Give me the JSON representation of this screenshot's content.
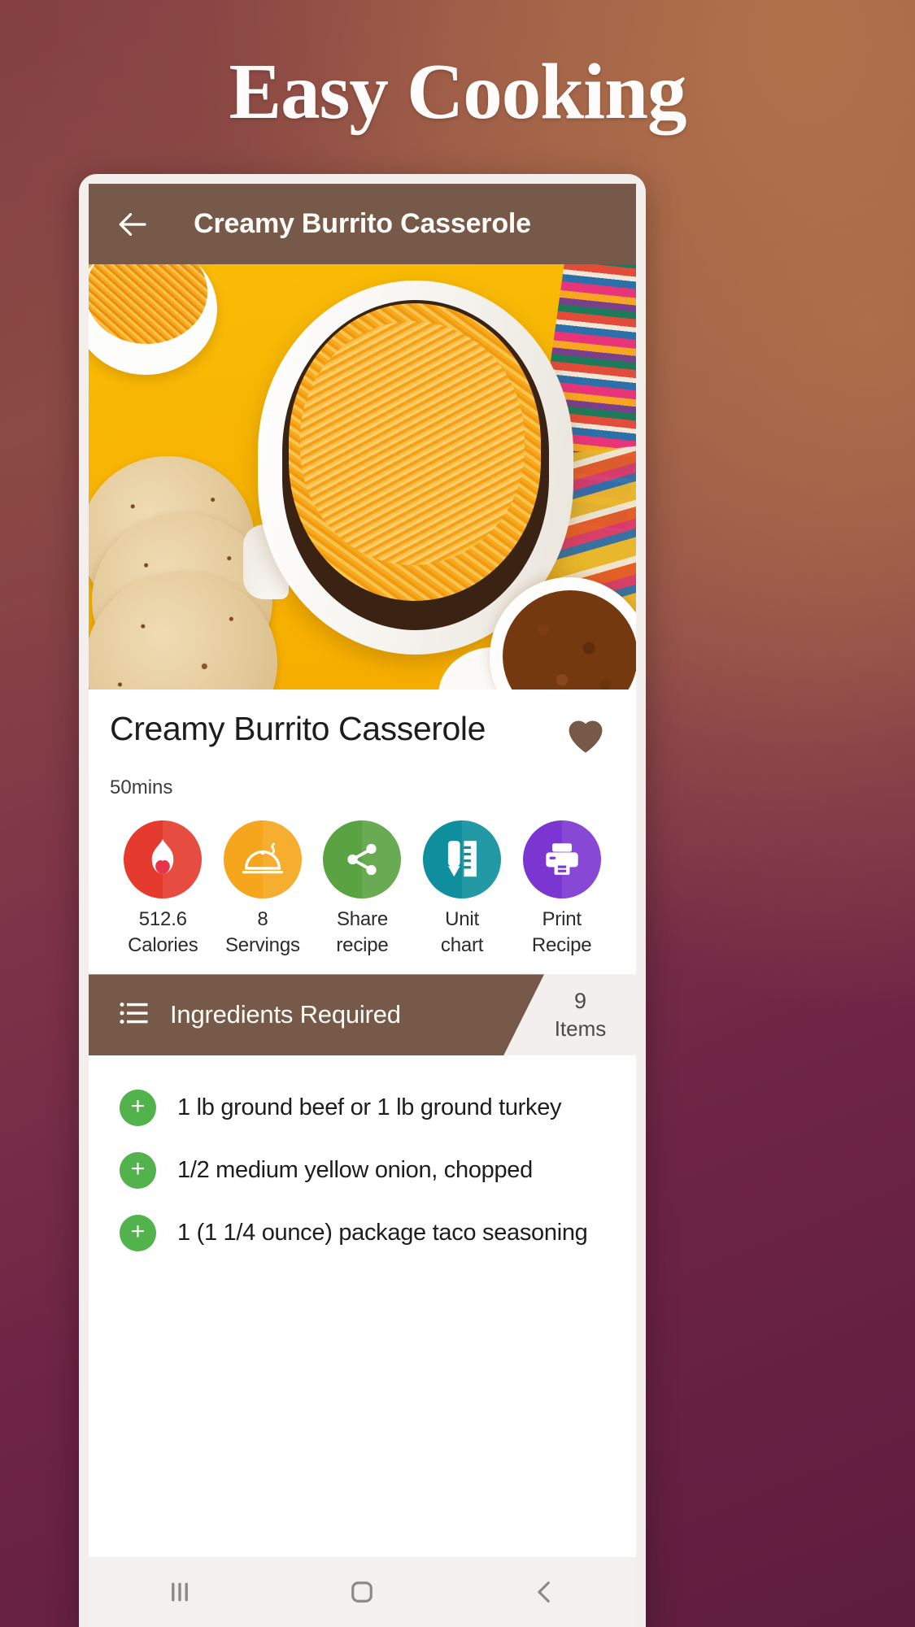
{
  "promo": {
    "title": "Easy Cooking"
  },
  "app_bar": {
    "back_icon": "arrow-left-icon",
    "title": "Creamy Burrito Casserole"
  },
  "recipe": {
    "photo_alt": "creamy burrito casserole dish with shredded cheese",
    "title": "Creamy Burrito Casserole",
    "time": "50mins",
    "favorite_icon": "heart-filled-icon",
    "favorite_color": "#77594a"
  },
  "actions": [
    {
      "icon": "flame-heart-icon",
      "color": "#e53b2e",
      "value": "512.6",
      "label": "Calories"
    },
    {
      "icon": "cloche-icon",
      "color": "#f6a61c",
      "value": "8",
      "label": "Servings"
    },
    {
      "icon": "share-icon",
      "color": "#5aa343",
      "value": "Share",
      "label": "recipe"
    },
    {
      "icon": "ruler-pencil-icon",
      "color": "#0f8f9e",
      "value": "Unit",
      "label": "chart"
    },
    {
      "icon": "printer-icon",
      "color": "#7b36d1",
      "value": "Print",
      "label": "Recipe"
    }
  ],
  "ingredients": {
    "icon": "list-icon",
    "title": "Ingredients Required",
    "count": "9",
    "count_unit": "Items",
    "add_icon": "plus-icon",
    "items": [
      "1 lb ground beef or 1 lb ground turkey",
      "1/2 medium yellow onion, chopped",
      "1 (1 1/4 ounce) package taco seasoning"
    ]
  },
  "system_nav": {
    "recents_icon": "recents-icon",
    "home_icon": "home-square-icon",
    "back_icon": "chevron-left-icon"
  }
}
